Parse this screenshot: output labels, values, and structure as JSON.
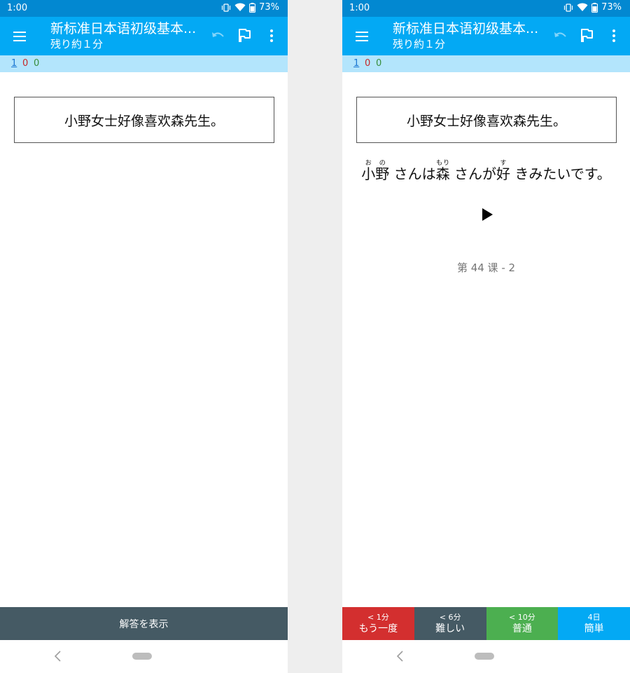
{
  "status": {
    "time": "1:00",
    "battery": "73%"
  },
  "appbar": {
    "title": "新标准日本语初级基本...",
    "subtitle": "残り約１分"
  },
  "counts": {
    "new": "1",
    "learning": "0",
    "review": "0"
  },
  "card": {
    "question": "小野女士好像喜欢森先生。",
    "answer": [
      {
        "base": "小野",
        "ruby": "おの"
      },
      {
        "text": " さんは"
      },
      {
        "base": "森",
        "ruby": "もり"
      },
      {
        "text": " さんが"
      },
      {
        "base": "好",
        "ruby": "す"
      },
      {
        "text": " きみたいです。"
      }
    ],
    "tag": "第 44 课 - 2"
  },
  "show_answer_label": "解答を表示",
  "ease_buttons": [
    {
      "interval": "< 1分",
      "label": "もう一度",
      "color": "#d32f2f"
    },
    {
      "interval": "< 6分",
      "label": "難しい",
      "color": "#455a64"
    },
    {
      "interval": "< 10分",
      "label": "普通",
      "color": "#4caf50"
    },
    {
      "interval": "4日",
      "label": "簡単",
      "color": "#03a9f4"
    }
  ],
  "colors": {
    "status_bar": "#0288d1",
    "app_bar": "#03a9f4",
    "count_bar": "#b3e5fc"
  }
}
